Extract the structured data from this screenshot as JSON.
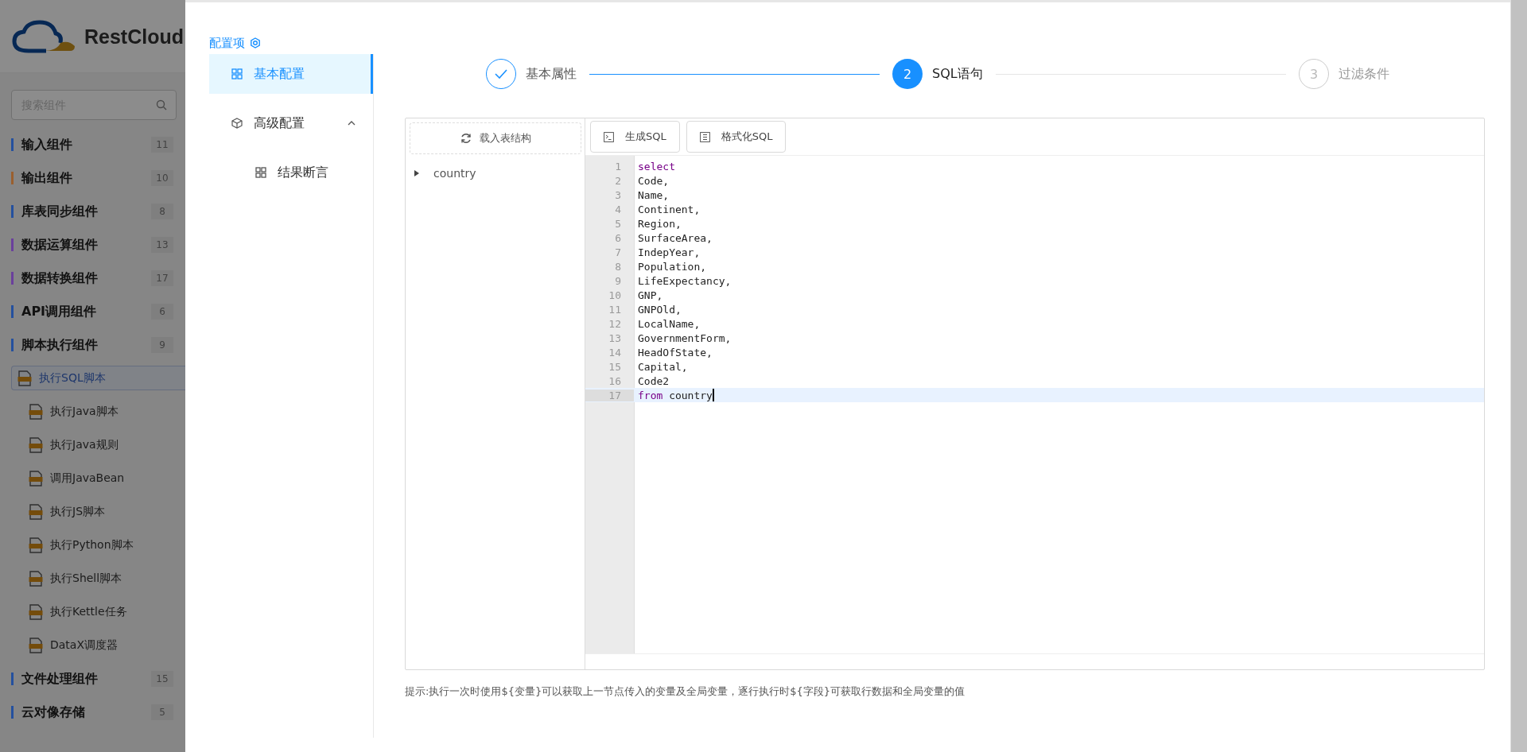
{
  "sidebar": {
    "logo": {
      "text": "RestCloud"
    },
    "search": {
      "placeholder": "搜索组件"
    },
    "categories": [
      {
        "label": "输入组件",
        "count": "11",
        "color": "#24509e"
      },
      {
        "label": "输出组件",
        "count": "10",
        "color": "#9a5f2e"
      },
      {
        "label": "库表同步组件",
        "count": "8",
        "color": "#24509e"
      },
      {
        "label": "数据运算组件",
        "count": "13",
        "color": "#6a3f9c"
      },
      {
        "label": "数据转换组件",
        "count": "17",
        "color": "#6a3f9c"
      },
      {
        "label": "API调用组件",
        "count": "6",
        "color": "#24509e"
      },
      {
        "label": "脚本执行组件",
        "count": "9",
        "color": "#24509e",
        "children": [
          {
            "label": "执行SQL脚本",
            "selected": true
          },
          {
            "label": "执行Java脚本",
            "selected": false
          },
          {
            "label": "执行Java规则",
            "selected": false
          },
          {
            "label": "调用JavaBean",
            "selected": false
          },
          {
            "label": "执行JS脚本",
            "selected": false
          },
          {
            "label": "执行Python脚本",
            "selected": false
          },
          {
            "label": "执行Shell脚本",
            "selected": false
          },
          {
            "label": "执行Kettle任务",
            "selected": false
          },
          {
            "label": "DataX调度器",
            "selected": false
          }
        ]
      },
      {
        "label": "文件处理组件",
        "count": "15",
        "color": "#24509e"
      },
      {
        "label": "云对像存储",
        "count": "5",
        "color": "#24509e"
      }
    ]
  },
  "config_panel": {
    "title": "配置项",
    "items": [
      {
        "label": "基本配置",
        "selected": true
      },
      {
        "label": "高级配置",
        "selected": false,
        "expanded": true,
        "children": [
          {
            "label": "结果断言",
            "selected": false
          }
        ]
      }
    ]
  },
  "steps": [
    {
      "title": "基本属性",
      "done": true,
      "current": false
    },
    {
      "number": "2",
      "title": "SQL语句",
      "done": false,
      "current": true
    },
    {
      "number": "3",
      "title": "过滤条件",
      "done": false,
      "current": false
    }
  ],
  "table_tree": {
    "load_button": "载入表结构",
    "nodes": [
      {
        "label": "country",
        "expanded": false
      }
    ]
  },
  "editor": {
    "buttons": [
      {
        "label": "生成SQL",
        "kind": "terminal"
      },
      {
        "label": "格式化SQL",
        "kind": "format"
      }
    ],
    "lines": [
      {
        "number": "1",
        "active": false,
        "tokens": [
          {
            "text": "select",
            "kind": "keyword"
          }
        ]
      },
      {
        "number": "2",
        "active": false,
        "tokens": [
          {
            "text": "Code,",
            "kind": "plain"
          }
        ]
      },
      {
        "number": "3",
        "active": false,
        "tokens": [
          {
            "text": "Name,",
            "kind": "plain"
          }
        ]
      },
      {
        "number": "4",
        "active": false,
        "tokens": [
          {
            "text": "Continent,",
            "kind": "plain"
          }
        ]
      },
      {
        "number": "5",
        "active": false,
        "tokens": [
          {
            "text": "Region,",
            "kind": "plain"
          }
        ]
      },
      {
        "number": "6",
        "active": false,
        "tokens": [
          {
            "text": "SurfaceArea,",
            "kind": "plain"
          }
        ]
      },
      {
        "number": "7",
        "active": false,
        "tokens": [
          {
            "text": "IndepYear,",
            "kind": "plain"
          }
        ]
      },
      {
        "number": "8",
        "active": false,
        "tokens": [
          {
            "text": "Population,",
            "kind": "plain"
          }
        ]
      },
      {
        "number": "9",
        "active": false,
        "tokens": [
          {
            "text": "LifeExpectancy,",
            "kind": "plain"
          }
        ]
      },
      {
        "number": "10",
        "active": false,
        "tokens": [
          {
            "text": "GNP,",
            "kind": "plain"
          }
        ]
      },
      {
        "number": "11",
        "active": false,
        "tokens": [
          {
            "text": "GNPOld,",
            "kind": "plain"
          }
        ]
      },
      {
        "number": "12",
        "active": false,
        "tokens": [
          {
            "text": "LocalName,",
            "kind": "plain"
          }
        ]
      },
      {
        "number": "13",
        "active": false,
        "tokens": [
          {
            "text": "GovernmentForm,",
            "kind": "plain"
          }
        ]
      },
      {
        "number": "14",
        "active": false,
        "tokens": [
          {
            "text": "HeadOfState,",
            "kind": "plain"
          }
        ]
      },
      {
        "number": "15",
        "active": false,
        "tokens": [
          {
            "text": "Capital,",
            "kind": "plain"
          }
        ]
      },
      {
        "number": "16",
        "active": false,
        "tokens": [
          {
            "text": "Code2",
            "kind": "plain"
          }
        ]
      },
      {
        "number": "17",
        "active": true,
        "tokens": [
          {
            "text": "from",
            "kind": "keyword"
          },
          {
            "text": " country",
            "kind": "plain"
          }
        ]
      }
    ]
  },
  "hint": "提示:执行一次时使用${变量}可以获取上一节点传入的变量及全局变量，逐行执行时${字段}可获取行数据和全局变量的值"
}
